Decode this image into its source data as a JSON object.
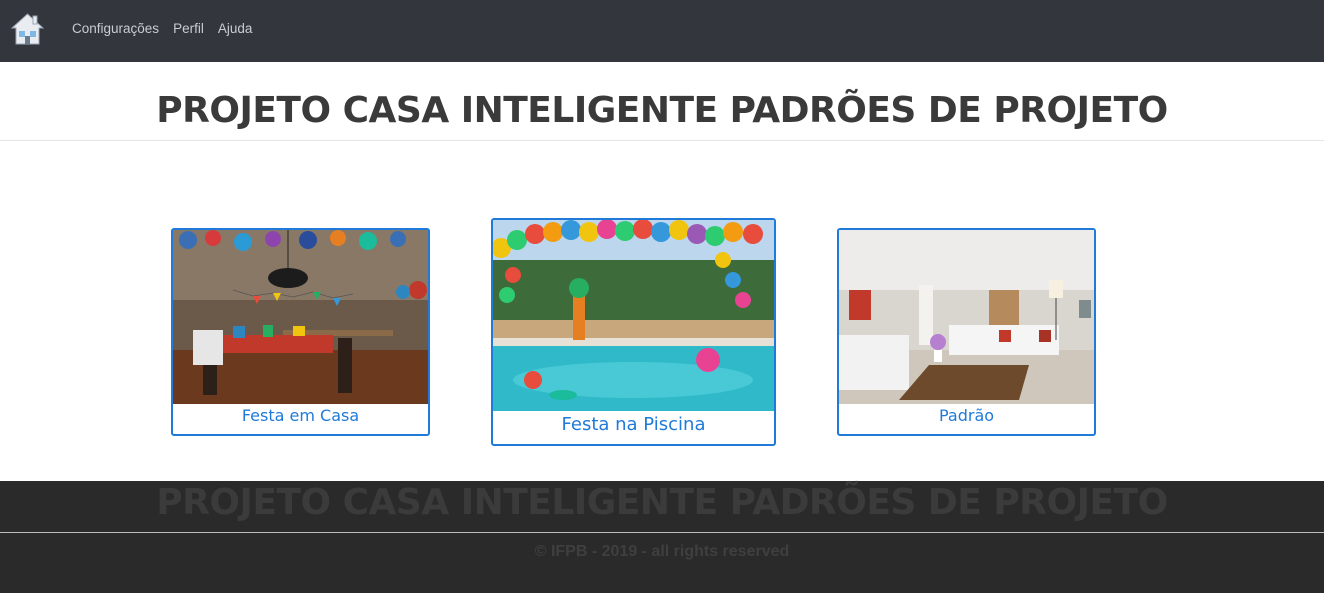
{
  "navbar": {
    "home_icon": "home-icon",
    "links": [
      "Configurações",
      "Perfil",
      "Ajuda"
    ]
  },
  "header": {
    "title": "PROJETO CASA INTELIGENTE PADRÕES DE PROJETO"
  },
  "cards": [
    {
      "label": "Festa em Casa",
      "image": "party-room-photo"
    },
    {
      "label": "Festa na Piscina",
      "image": "pool-party-photo"
    },
    {
      "label": "Padrão",
      "image": "living-room-photo"
    }
  ],
  "footer": {
    "title": "PROJETO CASA INTELIGENTE PADRÕES DE PROJETO",
    "copyright": "© IFPB - 2019 - all rights reserved"
  },
  "colors": {
    "navbar_bg": "#33363d",
    "accent": "#1f7ad9",
    "footer_bg": "#2a2a2a"
  }
}
